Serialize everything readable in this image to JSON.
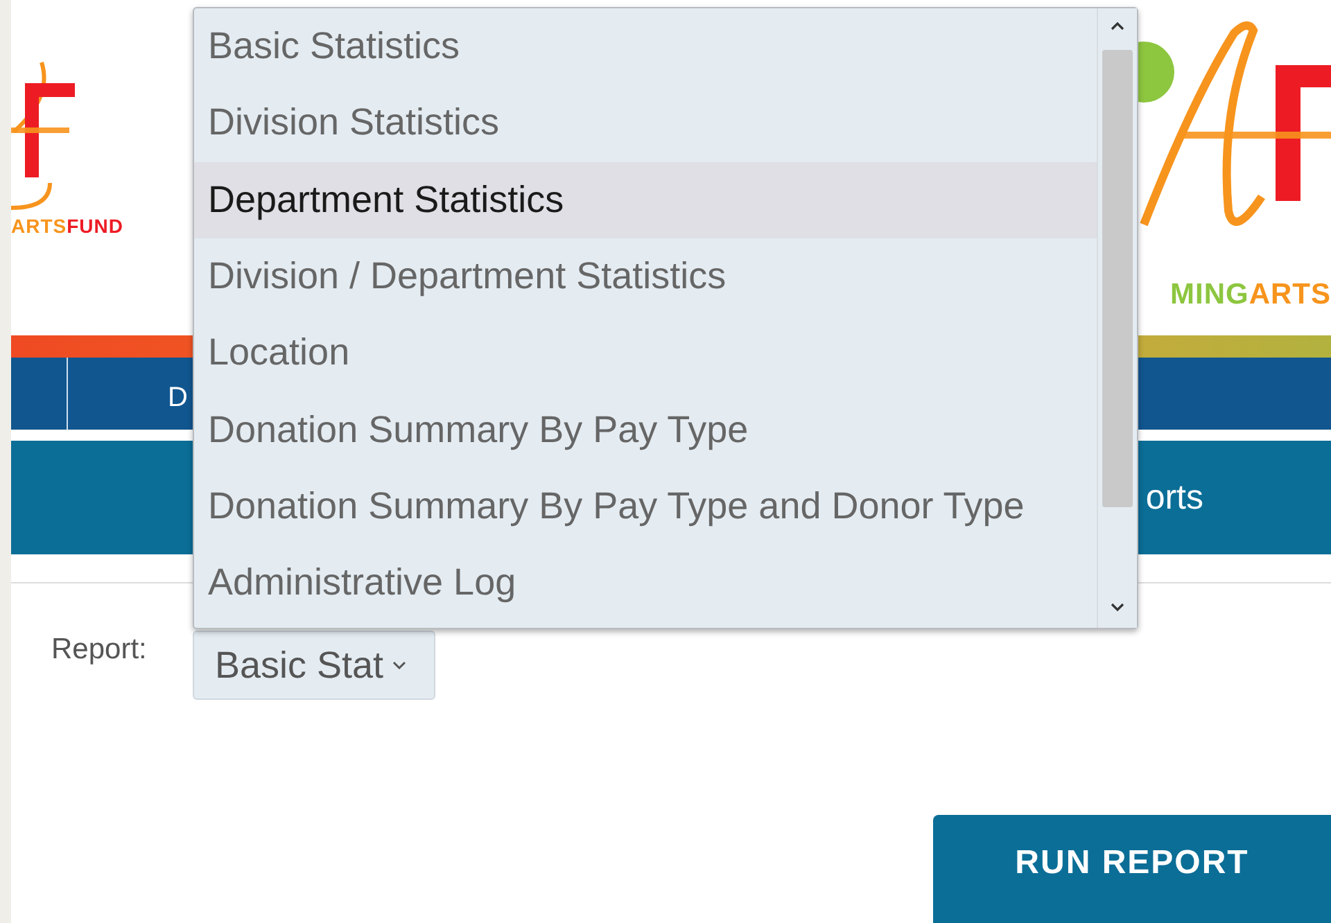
{
  "header": {
    "left_logo": {
      "parts": [
        "ARTS",
        "FUND"
      ]
    },
    "right_logo": {
      "parts": [
        "MING",
        "ARTS"
      ]
    }
  },
  "nav": {
    "item": "D"
  },
  "subnav": {
    "title": "orts"
  },
  "form": {
    "label": "Report:",
    "select_value": "Basic Stat"
  },
  "dropdown": {
    "options": [
      {
        "label": "Basic Statistics",
        "selected": false
      },
      {
        "label": "Division Statistics",
        "selected": false
      },
      {
        "label": "Department Statistics",
        "selected": true
      },
      {
        "label": "Division / Department Statistics",
        "selected": false
      },
      {
        "label": "Location",
        "selected": false
      },
      {
        "label": "Donation Summary By Pay Type",
        "selected": false
      },
      {
        "label": "Donation Summary By Pay Type and Donor Type",
        "selected": false
      },
      {
        "label": "Administrative Log",
        "selected": false
      }
    ]
  },
  "run_button": "RUN REPORT"
}
